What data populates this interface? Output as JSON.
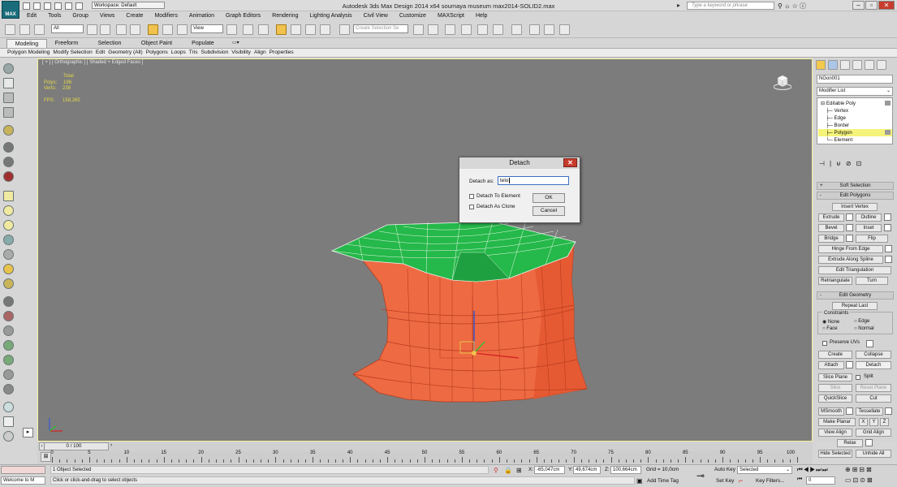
{
  "app": {
    "logo": "MAX",
    "title": "Autodesk 3ds Max Design 2014 x64    soumaya museum max2014-SOLID2.max",
    "workspace": "Workspace: Default",
    "search_placeholder": "Type a keyword or phrase"
  },
  "menu": [
    "Edit",
    "Tools",
    "Group",
    "Views",
    "Create",
    "Modifiers",
    "Animation",
    "Graph Editors",
    "Rendering",
    "Lighting Analysis",
    "Civil View",
    "Customize",
    "MAXScript",
    "Help"
  ],
  "toolbar": {
    "filter": "All",
    "refcoord": "View",
    "selection_set": "Create Selection Se"
  },
  "ribbon": {
    "tabs": [
      "Modeling",
      "Freeform",
      "Selection",
      "Object Paint",
      "Populate"
    ],
    "active": "Modeling",
    "sub": [
      "Polygon Modeling",
      "Modify Selection",
      "Edit",
      "Geometry (All)",
      "Polygons",
      "Loops",
      "Tris",
      "Subdivision",
      "Visibility",
      "Align",
      "Properties"
    ]
  },
  "viewport": {
    "label": "[ + ] [ Orthographic ] [ Shaded + Edged Faces ]",
    "stats": {
      "total": "Total",
      "polys_label": "Polys:",
      "polys": "196",
      "verts_label": "Verts:",
      "verts": "238",
      "fps_label": "FPS:",
      "fps": "158,265"
    },
    "colors": {
      "top": "#25b84a",
      "sides": "#ee6a43",
      "bg": "#7c7c7c"
    }
  },
  "dialog": {
    "title": "Detach",
    "detach_as_label": "Detach as:",
    "detach_as_value": "telo",
    "to_element": "Detach To Element",
    "as_clone": "Detach As Clone",
    "ok": "OK",
    "cancel": "Cancel"
  },
  "cmd": {
    "object_name": "NGon001",
    "modifier_list": "Modifier List",
    "stack": [
      "Editable Poly",
      "Vertex",
      "Edge",
      "Border",
      "Polygon",
      "Element"
    ],
    "selected_level": "Polygon",
    "soft_selection": "Soft Selection",
    "edit_polygons": "Edit Polygons",
    "insert_vertex": "Insert Vertex",
    "extrude": "Extrude",
    "outline": "Outline",
    "bevel": "Bevel",
    "inset": "Inset",
    "bridge": "Bridge",
    "flip": "Flip",
    "hinge": "Hinge From Edge",
    "extrude_spline": "Extrude Along Spline",
    "edit_tri": "Edit Triangulation",
    "retriangulate": "Retriangulate",
    "turn": "Turn",
    "edit_geometry": "Edit Geometry",
    "repeat_last": "Repeat Last",
    "constraints": "Constraints",
    "c_none": "None",
    "c_edge": "Edge",
    "c_face": "Face",
    "c_normal": "Normal",
    "preserve_uvs": "Preserve UVs",
    "create": "Create",
    "collapse": "Collapse",
    "attach": "Attach",
    "detach": "Detach",
    "slice_plane": "Slice Plane",
    "split": "Split",
    "slice": "Slice",
    "reset_plane": "Reset Plane",
    "quickslice": "QuickSlice",
    "cut": "Cut",
    "msmooth": "MSmooth",
    "tessellate": "Tessellate",
    "make_planar": "Make Planar",
    "x": "X",
    "y": "Y",
    "z": "Z",
    "view_align": "View Align",
    "grid_align": "Grid Align",
    "relax": "Relax",
    "hide_selected": "Hide Selected",
    "unhide_all": "Unhide All"
  },
  "timeline": {
    "frame": "0 / 100",
    "ticks": [
      "0",
      "5",
      "10",
      "15",
      "20",
      "25",
      "30",
      "35",
      "40",
      "45",
      "50",
      "55",
      "60",
      "65",
      "70",
      "75",
      "80",
      "85",
      "90",
      "95",
      "100"
    ]
  },
  "status": {
    "maxscript": "Welcome to M",
    "selected": "1 Object Selected",
    "prompt": "Click or click-and-drag to select objects",
    "x_label": "X:",
    "x": "-65,047cm",
    "y_label": "Y:",
    "y": "49,674cm",
    "z_label": "Z:",
    "z": "100,664cm",
    "grid": "Grid = 10,0cm",
    "add_time_tag": "Add Time Tag",
    "auto_key": "Auto Key",
    "set_key": "Set Key",
    "key_mode": "Selected",
    "key_filters": "Key Filters...",
    "frame_field": "0"
  }
}
